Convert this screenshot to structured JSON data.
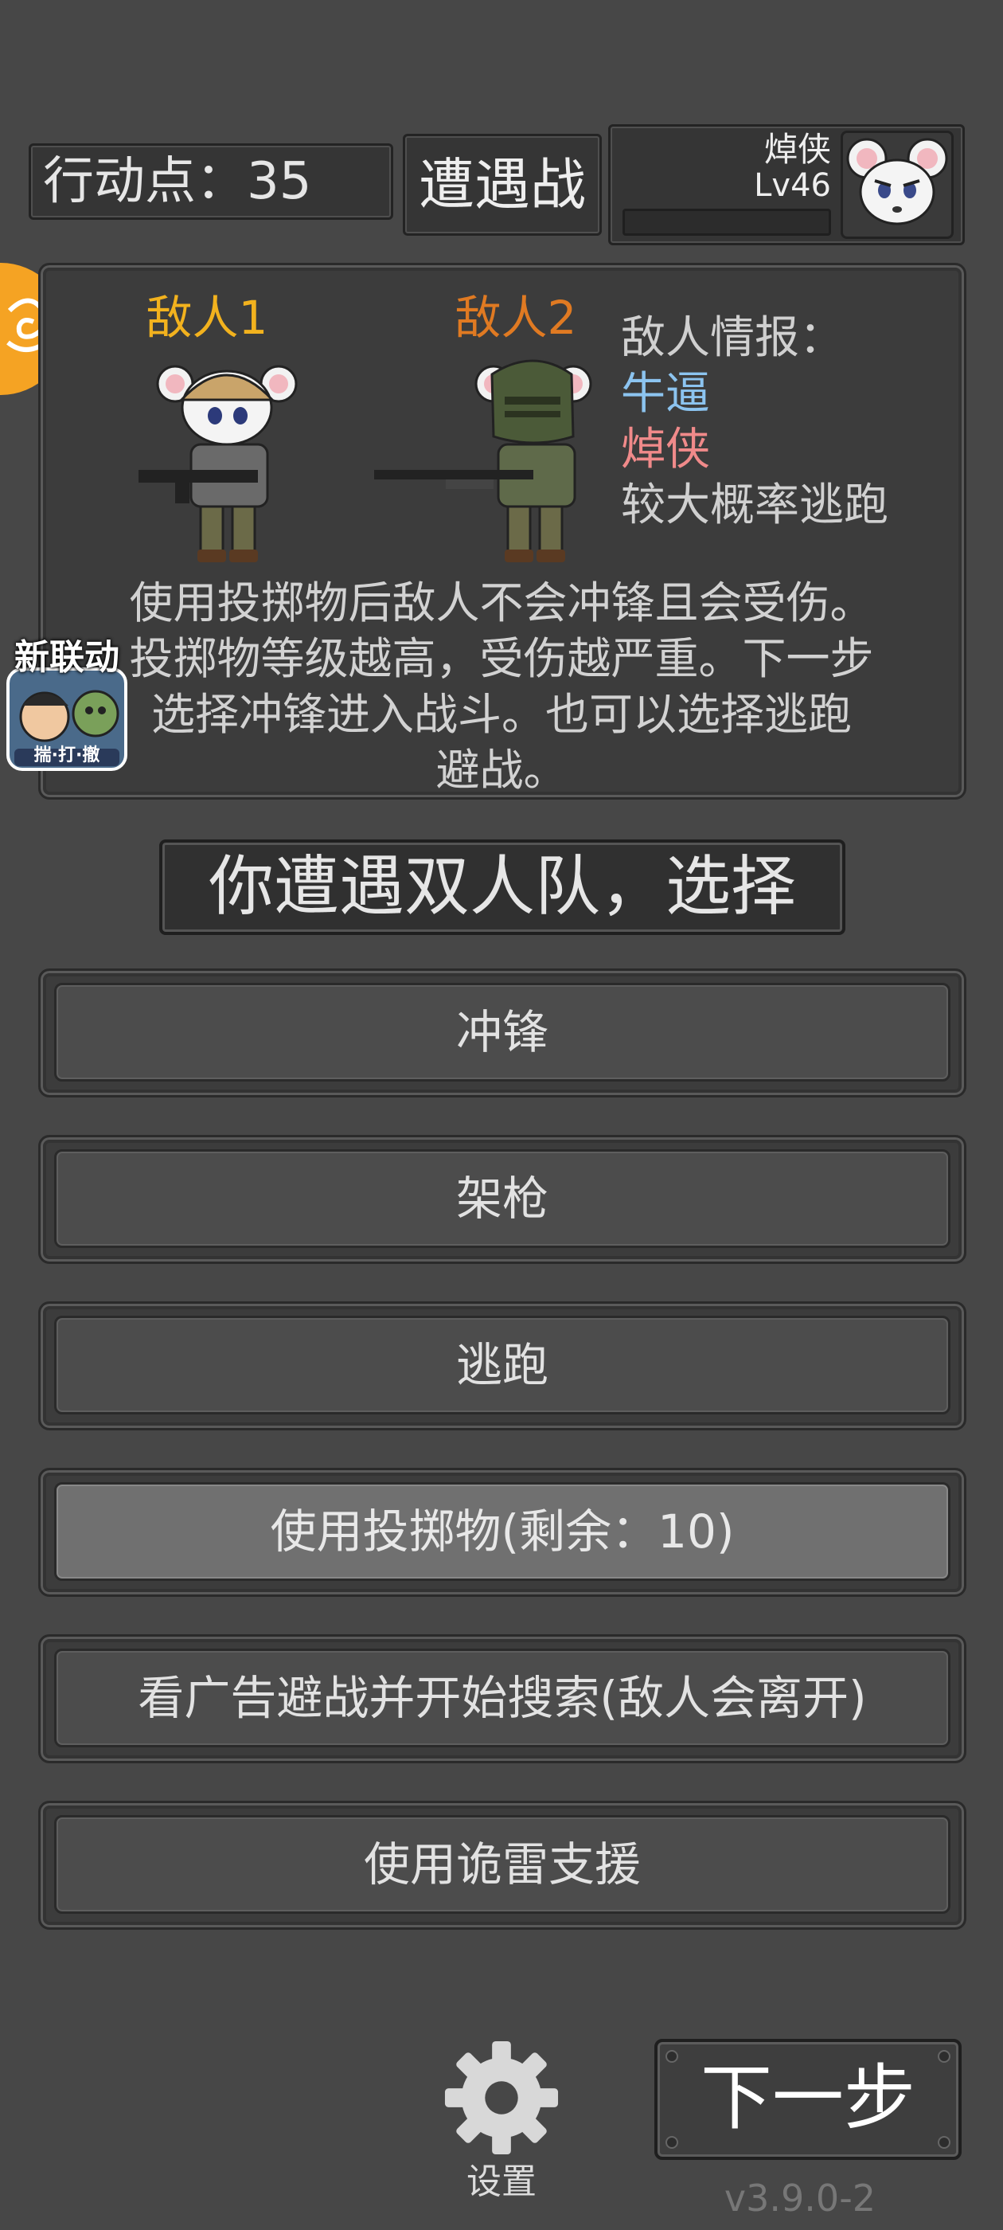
{
  "top_bar": {
    "action_points_label": "行动点：35",
    "encounter_title": "遭遇战",
    "player_name": "焯侠",
    "player_level": "Lv46"
  },
  "battle": {
    "enemy1_label": "敌人1",
    "enemy2_label": "敌人2",
    "enemy1_color": "#f2b21e",
    "enemy2_color": "#e07a22",
    "intel_title": "敌人情报：",
    "intel_lines": [
      {
        "text": "牛逼",
        "color": "#8cc4f0"
      },
      {
        "text": "焯侠",
        "color": "#f08a8a"
      },
      {
        "text": "较大概率逃跑",
        "color": "#d0d0d0"
      }
    ],
    "hint_lines": [
      "使用投掷物后敌人不会冲锋且会受伤。",
      "投掷物等级越高，受伤越严重。下一步",
      "选择冲锋进入战斗。也可以选择逃跑",
      "避战。"
    ]
  },
  "collab_badge": {
    "title": "新联动",
    "subtitle": "揣·打·撤"
  },
  "message": "你遭遇双人队，选择",
  "actions": [
    {
      "label": "冲锋",
      "highlight": false
    },
    {
      "label": "架枪",
      "highlight": false
    },
    {
      "label": "逃跑",
      "highlight": false
    },
    {
      "label": "使用投掷物(剩余：10)",
      "highlight": true
    },
    {
      "label": "看广告避战并开始搜索(敌人会离开)",
      "highlight": false
    },
    {
      "label": "使用诡雷支援",
      "highlight": false
    }
  ],
  "bottom": {
    "settings_label": "设置",
    "next_label": "下一步",
    "version": "v3.9.0-2"
  },
  "icons": {
    "settings": "gear-icon",
    "side_badge": "swirl-icon",
    "avatar": "white-mouse-avatar",
    "enemy1": "mouse-soldier-helmet",
    "enemy2": "mouse-soldier-mask"
  }
}
